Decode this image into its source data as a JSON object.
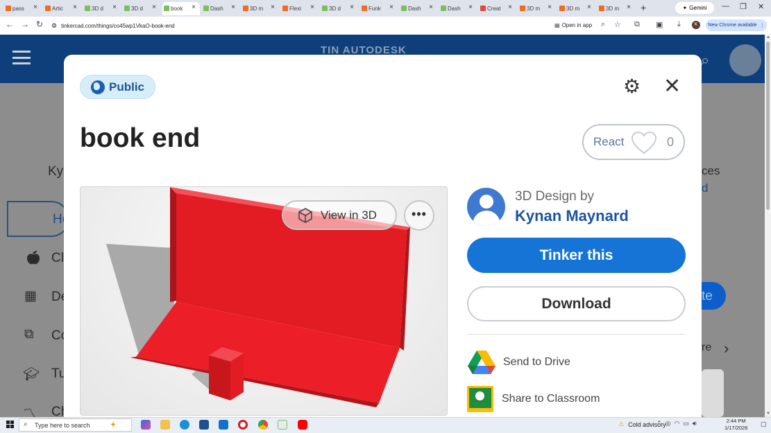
{
  "browser": {
    "tabs": [
      {
        "title": "pass",
        "icon_color": "#f26b21",
        "active": false
      },
      {
        "title": "Artic",
        "icon_color": "#f26b21",
        "active": false
      },
      {
        "title": "3D d",
        "icon_color": "#7bbf5a",
        "active": false
      },
      {
        "title": "3D d",
        "icon_color": "#7bbf5a",
        "active": false
      },
      {
        "title": "book",
        "icon_color": "#7bbf5a",
        "active": true
      },
      {
        "title": "Dash",
        "icon_color": "#7bbf5a",
        "active": false
      },
      {
        "title": "3D m",
        "icon_color": "#f26b21",
        "active": false
      },
      {
        "title": "Flexi",
        "icon_color": "#f26b21",
        "active": false
      },
      {
        "title": "3D d",
        "icon_color": "#7bbf5a",
        "active": false
      },
      {
        "title": "Funk",
        "icon_color": "#f26b21",
        "active": false
      },
      {
        "title": "Dash",
        "icon_color": "#7bbf5a",
        "active": false
      },
      {
        "title": "Dash",
        "icon_color": "#7bbf5a",
        "active": false
      },
      {
        "title": "Creat",
        "icon_color": "#e8473a",
        "active": false
      },
      {
        "title": "3D m",
        "icon_color": "#f26b21",
        "active": false
      },
      {
        "title": "3D m",
        "icon_color": "#f26b21",
        "active": false
      },
      {
        "title": "3D m",
        "icon_color": "#f26b21",
        "active": false
      }
    ],
    "new_tab_icon": "+",
    "gemini_label": "Gemini",
    "url": "tinkercad.com/things/co45wp1VkaO-book-end",
    "open_in_app": "Open in app",
    "profile_initial": "K",
    "new_chrome": "New Chrome available"
  },
  "background": {
    "brand": "TIN AUTODESK",
    "left_words": [
      "Ky",
      "Ho",
      "Cl",
      "De",
      "Co",
      "Tu",
      "Ch"
    ],
    "right_words": [
      "ces",
      "d",
      "te",
      "re"
    ]
  },
  "modal": {
    "visibility": "Public",
    "title": "book end",
    "react_label": "React",
    "react_count": "0",
    "view_in_3d": "View in 3D",
    "more_icon": "•••",
    "design_by": "3D Design by",
    "author": "Kynan Maynard",
    "tinker_button": "Tinker this",
    "download_button": "Download",
    "send_to_drive": "Send to Drive",
    "share_to_classroom": "Share to Classroom",
    "colors": {
      "tinker_blue": "#1674d6",
      "model_red": "#e31b23",
      "public_pill": "#d7eefa"
    }
  },
  "taskbar": {
    "search_placeholder": "Type here to search",
    "weather": "Cold advisory",
    "time": "2:44 PM",
    "date": "1/17/2026"
  }
}
